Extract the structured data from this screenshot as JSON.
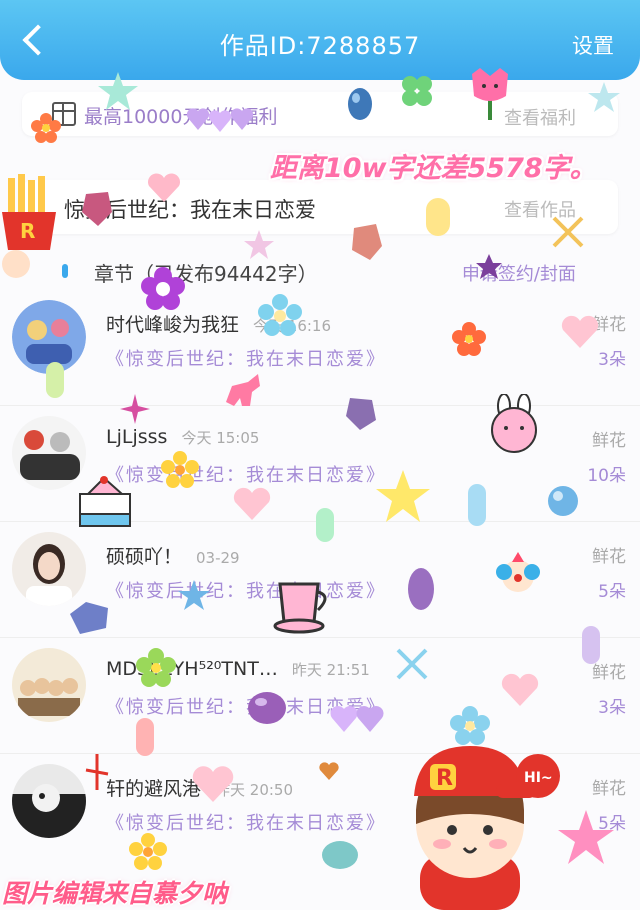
{
  "header": {
    "title": "作品ID:7288857",
    "settings_label": "设置"
  },
  "benefit": {
    "text": "最高10000元创作福利",
    "link": "查看福利"
  },
  "banner_text": "距离10w字还差5578字。",
  "work": {
    "title": "惊变后世纪：我在末日恋爱",
    "link": "查看作品"
  },
  "chapters": {
    "label": "章节（已发布94442字）",
    "action": "申请签约/封面"
  },
  "gifts": [
    {
      "name": "时代峰峻为我狂",
      "time": "今天 16:16",
      "book": "《惊变后世纪：我在末日恋爱》",
      "flower_label": "鲜花",
      "flower_count": "3朵"
    },
    {
      "name": "LjLjsss",
      "time": "今天 15:05",
      "book": "《惊变后世纪：我在末日恋爱》",
      "flower_label": "鲜花",
      "flower_count": "10朵"
    },
    {
      "name": "硕硕吖！",
      "time": "03-29",
      "book": "《惊变后世纪：我在末日恋爱》",
      "flower_label": "鲜花",
      "flower_count": "5朵"
    },
    {
      "name": "MDSLZYH⁵²⁰TNT…",
      "time": "昨天 21:51",
      "book": "《惊变后世纪：我在末日恋爱》",
      "flower_label": "鲜花",
      "flower_count": "3朵"
    },
    {
      "name": "轩的避风港",
      "time": "昨天 20:50",
      "book": "《惊变后世纪：我在末日恋爱》",
      "flower_label": "鲜花",
      "flower_count": "5朵"
    }
  ],
  "watermark": "图片编辑来自慕夕呐",
  "sticker_hi": "HI~",
  "sticker_r": "R",
  "colors": {
    "header": "#3aa8ec",
    "accent_purple": "#a58bd6",
    "banner_pink": "#ff6fa8"
  }
}
